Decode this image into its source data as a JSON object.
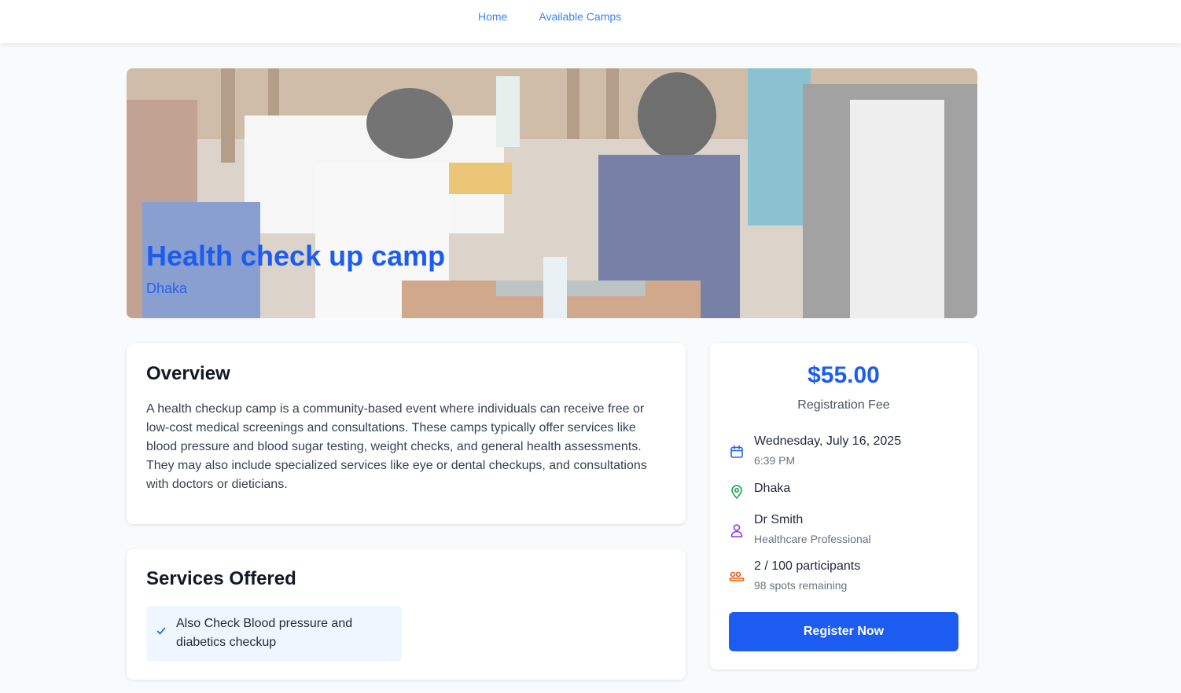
{
  "nav": {
    "home_label": "Home",
    "camps_label": "Available Camps"
  },
  "hero": {
    "title": "Health check up camp",
    "location": "Dhaka",
    "image_icon": "health-camp-photo"
  },
  "overview": {
    "heading": "Overview",
    "text": "A health checkup camp is a community-based event where individuals can receive free or low-cost medical screenings and consultations. These camps typically offer services like blood pressure and blood sugar testing, weight checks, and general health assessments. They may also include specialized services like eye or dental checkups, and consultations with doctors or dieticians."
  },
  "services": {
    "heading": "Services Offered",
    "items": [
      {
        "label": "Also Check Blood pressure and diabetics checkup",
        "icon": "check-icon"
      }
    ]
  },
  "sidebar": {
    "price": "$55.00",
    "price_label": "Registration Fee",
    "date": "Wednesday, July 16, 2025",
    "time": "6:39 PM",
    "location": "Dhaka",
    "doctor": "Dr Smith",
    "doctor_role": "Healthcare Professional",
    "participants": "2 / 100 participants",
    "spots_remaining": "98 spots remaining",
    "register_label": "Register Now"
  },
  "colors": {
    "primary": "#1d5cf0",
    "nav_link": "#3b82f6",
    "calendar_icon": "#2563eb",
    "location_icon": "#16a34a",
    "person_icon": "#9333ea",
    "participants_icon": "#ea580c",
    "service_bg": "#eff6ff",
    "page_bg": "#f8fafc"
  }
}
